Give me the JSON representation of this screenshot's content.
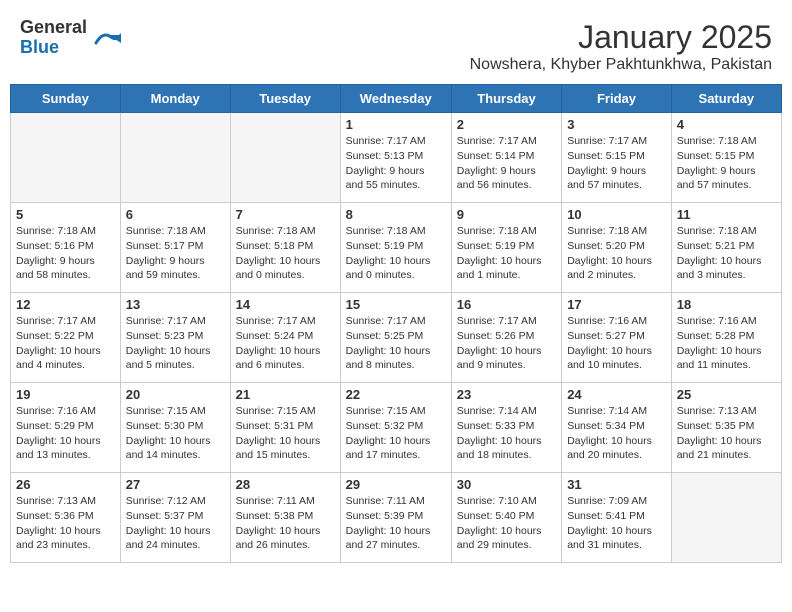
{
  "header": {
    "logo_general": "General",
    "logo_blue": "Blue",
    "title": "January 2025",
    "subtitle": "Nowshera, Khyber Pakhtunkhwa, Pakistan"
  },
  "weekdays": [
    "Sunday",
    "Monday",
    "Tuesday",
    "Wednesday",
    "Thursday",
    "Friday",
    "Saturday"
  ],
  "weeks": [
    [
      {
        "day": "",
        "info": ""
      },
      {
        "day": "",
        "info": ""
      },
      {
        "day": "",
        "info": ""
      },
      {
        "day": "1",
        "info": "Sunrise: 7:17 AM\nSunset: 5:13 PM\nDaylight: 9 hours\nand 55 minutes."
      },
      {
        "day": "2",
        "info": "Sunrise: 7:17 AM\nSunset: 5:14 PM\nDaylight: 9 hours\nand 56 minutes."
      },
      {
        "day": "3",
        "info": "Sunrise: 7:17 AM\nSunset: 5:15 PM\nDaylight: 9 hours\nand 57 minutes."
      },
      {
        "day": "4",
        "info": "Sunrise: 7:18 AM\nSunset: 5:15 PM\nDaylight: 9 hours\nand 57 minutes."
      }
    ],
    [
      {
        "day": "5",
        "info": "Sunrise: 7:18 AM\nSunset: 5:16 PM\nDaylight: 9 hours\nand 58 minutes."
      },
      {
        "day": "6",
        "info": "Sunrise: 7:18 AM\nSunset: 5:17 PM\nDaylight: 9 hours\nand 59 minutes."
      },
      {
        "day": "7",
        "info": "Sunrise: 7:18 AM\nSunset: 5:18 PM\nDaylight: 10 hours\nand 0 minutes."
      },
      {
        "day": "8",
        "info": "Sunrise: 7:18 AM\nSunset: 5:19 PM\nDaylight: 10 hours\nand 0 minutes."
      },
      {
        "day": "9",
        "info": "Sunrise: 7:18 AM\nSunset: 5:19 PM\nDaylight: 10 hours\nand 1 minute."
      },
      {
        "day": "10",
        "info": "Sunrise: 7:18 AM\nSunset: 5:20 PM\nDaylight: 10 hours\nand 2 minutes."
      },
      {
        "day": "11",
        "info": "Sunrise: 7:18 AM\nSunset: 5:21 PM\nDaylight: 10 hours\nand 3 minutes."
      }
    ],
    [
      {
        "day": "12",
        "info": "Sunrise: 7:17 AM\nSunset: 5:22 PM\nDaylight: 10 hours\nand 4 minutes."
      },
      {
        "day": "13",
        "info": "Sunrise: 7:17 AM\nSunset: 5:23 PM\nDaylight: 10 hours\nand 5 minutes."
      },
      {
        "day": "14",
        "info": "Sunrise: 7:17 AM\nSunset: 5:24 PM\nDaylight: 10 hours\nand 6 minutes."
      },
      {
        "day": "15",
        "info": "Sunrise: 7:17 AM\nSunset: 5:25 PM\nDaylight: 10 hours\nand 8 minutes."
      },
      {
        "day": "16",
        "info": "Sunrise: 7:17 AM\nSunset: 5:26 PM\nDaylight: 10 hours\nand 9 minutes."
      },
      {
        "day": "17",
        "info": "Sunrise: 7:16 AM\nSunset: 5:27 PM\nDaylight: 10 hours\nand 10 minutes."
      },
      {
        "day": "18",
        "info": "Sunrise: 7:16 AM\nSunset: 5:28 PM\nDaylight: 10 hours\nand 11 minutes."
      }
    ],
    [
      {
        "day": "19",
        "info": "Sunrise: 7:16 AM\nSunset: 5:29 PM\nDaylight: 10 hours\nand 13 minutes."
      },
      {
        "day": "20",
        "info": "Sunrise: 7:15 AM\nSunset: 5:30 PM\nDaylight: 10 hours\nand 14 minutes."
      },
      {
        "day": "21",
        "info": "Sunrise: 7:15 AM\nSunset: 5:31 PM\nDaylight: 10 hours\nand 15 minutes."
      },
      {
        "day": "22",
        "info": "Sunrise: 7:15 AM\nSunset: 5:32 PM\nDaylight: 10 hours\nand 17 minutes."
      },
      {
        "day": "23",
        "info": "Sunrise: 7:14 AM\nSunset: 5:33 PM\nDaylight: 10 hours\nand 18 minutes."
      },
      {
        "day": "24",
        "info": "Sunrise: 7:14 AM\nSunset: 5:34 PM\nDaylight: 10 hours\nand 20 minutes."
      },
      {
        "day": "25",
        "info": "Sunrise: 7:13 AM\nSunset: 5:35 PM\nDaylight: 10 hours\nand 21 minutes."
      }
    ],
    [
      {
        "day": "26",
        "info": "Sunrise: 7:13 AM\nSunset: 5:36 PM\nDaylight: 10 hours\nand 23 minutes."
      },
      {
        "day": "27",
        "info": "Sunrise: 7:12 AM\nSunset: 5:37 PM\nDaylight: 10 hours\nand 24 minutes."
      },
      {
        "day": "28",
        "info": "Sunrise: 7:11 AM\nSunset: 5:38 PM\nDaylight: 10 hours\nand 26 minutes."
      },
      {
        "day": "29",
        "info": "Sunrise: 7:11 AM\nSunset: 5:39 PM\nDaylight: 10 hours\nand 27 minutes."
      },
      {
        "day": "30",
        "info": "Sunrise: 7:10 AM\nSunset: 5:40 PM\nDaylight: 10 hours\nand 29 minutes."
      },
      {
        "day": "31",
        "info": "Sunrise: 7:09 AM\nSunset: 5:41 PM\nDaylight: 10 hours\nand 31 minutes."
      },
      {
        "day": "",
        "info": ""
      }
    ]
  ]
}
